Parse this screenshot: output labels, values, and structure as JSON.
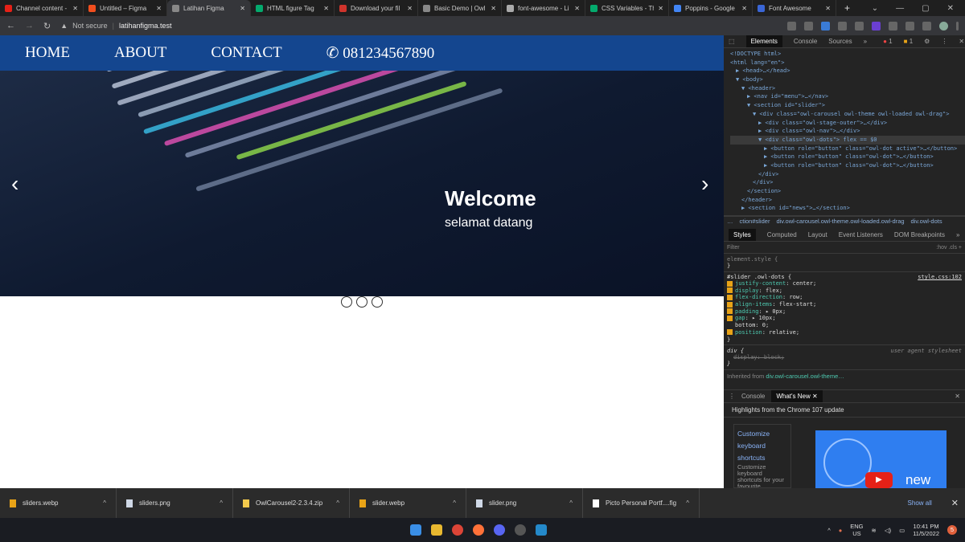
{
  "browser": {
    "tabs": [
      {
        "title": "Channel content -",
        "color": "#e62117"
      },
      {
        "title": "Untitled – Figma",
        "color": "#f24e1e"
      },
      {
        "title": "Latihan Figma",
        "color": "#888888",
        "active": true
      },
      {
        "title": "HTML figure Tag",
        "color": "#04aa6d"
      },
      {
        "title": "Download your fil",
        "color": "#d0342c"
      },
      {
        "title": "Basic Demo | Owl",
        "color": "#888888"
      },
      {
        "title": "font-awesome - Li",
        "color": "#aaaaaa"
      },
      {
        "title": "CSS Variables - The",
        "color": "#04aa6d"
      },
      {
        "title": "Poppins - Google",
        "color": "#4285f4"
      },
      {
        "title": "Font Awesome",
        "color": "#3a66d6"
      }
    ],
    "new_tab": "+",
    "security": "Not secure",
    "url": "latihanfigma.test"
  },
  "site": {
    "nav": [
      "HOME",
      "ABOUT",
      "CONTACT"
    ],
    "phone": "081234567890",
    "slider": {
      "title": "Welcome",
      "subtitle": "selamat datang",
      "prev": "‹",
      "next": "›",
      "dots": 3,
      "active_dot": 0
    }
  },
  "devtools": {
    "tabs": [
      "Elements",
      "Console",
      "Sources",
      "»"
    ],
    "errors": "1",
    "warnings": "1",
    "dom": [
      {
        "t": "<!DOCTYPE html>",
        "i": 0
      },
      {
        "t": "<html lang=\"en\">",
        "i": 0
      },
      {
        "t": "▶ <head>…</head>",
        "i": 1
      },
      {
        "t": "▼ <body>",
        "i": 1
      },
      {
        "t": "▼ <header>",
        "i": 2
      },
      {
        "t": "▶ <nav id=\"menu\">…</nav>",
        "i": 3
      },
      {
        "t": "▼ <section id=\"slider\">",
        "i": 3
      },
      {
        "t": "▼ <div class=\"owl-carousel owl-theme owl-loaded owl-drag\">",
        "i": 4
      },
      {
        "t": "▶ <div class=\"owl-stage-outer\">…</div>",
        "i": 5
      },
      {
        "t": "▶ <div class=\"owl-nav\">…</div>",
        "i": 5
      },
      {
        "t": "▼ <div class=\"owl-dots\"> flex == $0",
        "i": 5,
        "sel": true
      },
      {
        "t": "▶ <button role=\"button\" class=\"owl-dot active\">…</button>",
        "i": 6
      },
      {
        "t": "▶ <button role=\"button\" class=\"owl-dot\">…</button>",
        "i": 6
      },
      {
        "t": "▶ <button role=\"button\" class=\"owl-dot\">…</button>",
        "i": 6
      },
      {
        "t": "</div>",
        "i": 5
      },
      {
        "t": "</div>",
        "i": 4
      },
      {
        "t": "</section>",
        "i": 3
      },
      {
        "t": "</header>",
        "i": 2
      },
      {
        "t": "▶ <section id=\"news\">…</section>",
        "i": 2
      }
    ],
    "breadcrumbs": [
      "…",
      "ction#slider",
      "div.owl-carousel.owl-theme.owl-loaded.owl-drag",
      "div.owl-dots"
    ],
    "style_tabs": [
      "Styles",
      "Computed",
      "Layout",
      "Event Listeners",
      "DOM Breakpoints",
      "»"
    ],
    "filter_placeholder": "Filter",
    "filter_tools": ":hov  .cls  +",
    "element_style": "element.style {",
    "close_brace": "}",
    "rule_selector": "#slider .owl-dots {",
    "rule_source": "style.css:102",
    "props": [
      {
        "n": "justify-content",
        "v": "center;",
        "c": true
      },
      {
        "n": "display",
        "v": "flex;",
        "c": true
      },
      {
        "n": "flex-direction",
        "v": "row;",
        "c": true
      },
      {
        "n": "align-items",
        "v": "flex-start;",
        "c": true
      },
      {
        "n": "padding",
        "v": "▸ 0px;",
        "c": true
      },
      {
        "n": "gap",
        "v": "▸ 10px;",
        "c": true
      },
      {
        "n": "bottom",
        "v": "0;",
        "c": false
      },
      {
        "n": "position",
        "v": "relative;",
        "c": true
      }
    ],
    "ua_selector": "div {",
    "ua_source": "user agent stylesheet",
    "ua_prop": "display: block;",
    "inherited": "Inherited from",
    "inherited_link": "div.owl-carousel.owl-theme…",
    "drawer_tabs": [
      "Console",
      "What's New"
    ],
    "whatsnew_title": "Highlights from the Chrome 107 update",
    "whatsnew_link": [
      "Customize",
      "keyboard",
      "shortcuts"
    ],
    "whatsnew_desc": "Customize keyboard shortcuts for your favourite commands in",
    "video_text": "new"
  },
  "downloads": {
    "items": [
      {
        "name": "sliders.webp",
        "color": "#e8a317"
      },
      {
        "name": "sliders.png",
        "color": "#cfd8e6"
      },
      {
        "name": "OwlCarousel2-2.3.4.zip",
        "color": "#f2c94c"
      },
      {
        "name": "slider.webp",
        "color": "#e8a317"
      },
      {
        "name": "slider.png",
        "color": "#cfd8e6"
      },
      {
        "name": "Picto Personal Portf....fig",
        "color": "#ffffff"
      }
    ],
    "show_all": "Show all"
  },
  "taskbar": {
    "lang": "ENG",
    "region": "US",
    "time": "10:41 PM",
    "date": "11/5/2022",
    "badge": "5"
  }
}
